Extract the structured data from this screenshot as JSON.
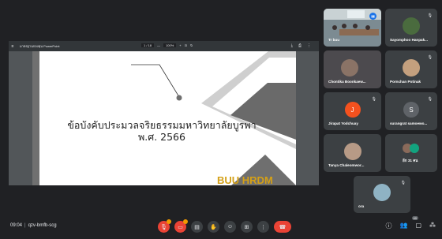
{
  "meeting": {
    "time": "09:04",
    "code": "qzv-bmfb-scg"
  },
  "presentation": {
    "file_name": "มาตรฐานกองทุน PowerPoint",
    "page": "1 / 18",
    "zoom": "100%",
    "slide_title_line1": "ข้อบังคับประมวลจริยธรรมมหาวิทยาลัยบูรพา",
    "slide_title_line2": "พ.ศ. 2566",
    "slide_logo": "BUU HRDM"
  },
  "tiles": [
    {
      "name": "Tr buu",
      "type": "room"
    },
    {
      "name": "Sayomphoo Hanpak...",
      "type": "photo"
    },
    {
      "name": "Chontika Boonkaew...",
      "type": "photo"
    },
    {
      "name": "Pornchan Potinak",
      "type": "photo"
    },
    {
      "name": "Jirapat Yodchuay",
      "type": "initial",
      "initial": "J",
      "color": "#f4511e"
    },
    {
      "name": "surangrat samoewo...",
      "type": "initial",
      "initial": "S",
      "color": "#5f6368"
    },
    {
      "name": "Tanya Chaleomwor...",
      "type": "photo"
    },
    {
      "name": "อีก 31 คน",
      "type": "more"
    },
    {
      "name": "ora",
      "type": "photo"
    }
  ],
  "participant_count": "40",
  "colors": {
    "background": "#202124",
    "tile": "#3c4043",
    "end_call": "#ea4335",
    "accent": "#1a73e8"
  }
}
